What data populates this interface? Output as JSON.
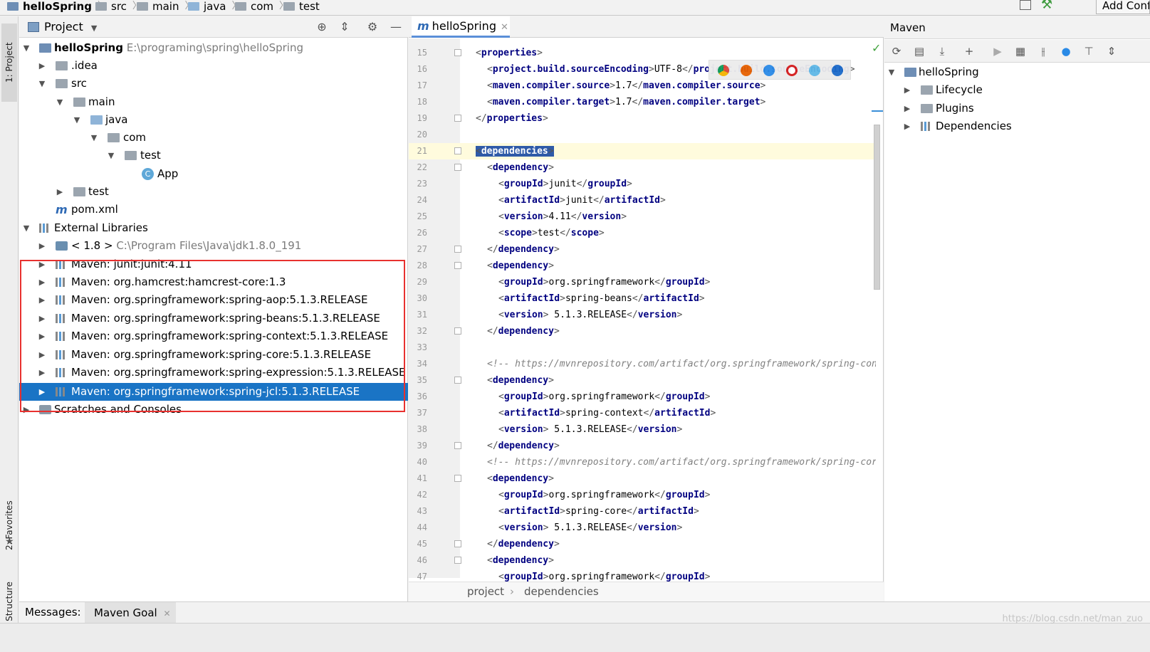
{
  "navbar": {
    "crumbs": [
      "helloSpring",
      "src",
      "main",
      "java",
      "com",
      "test"
    ],
    "add_config": "Add Conf"
  },
  "left_strip": {
    "project_tab": "1: Project",
    "favorites_tab": "2: Favorites",
    "structure_tab": "Z: Structure"
  },
  "project_panel": {
    "title": "Project",
    "tree": [
      {
        "label": "helloSpring",
        "path": "E:\\programing\\spring\\helloSpring"
      },
      {
        "label": ".idea"
      },
      {
        "label": "src"
      },
      {
        "label": "main"
      },
      {
        "label": "java"
      },
      {
        "label": "com"
      },
      {
        "label": "test"
      },
      {
        "label": "App"
      },
      {
        "label": "test"
      },
      {
        "label": "pom.xml"
      },
      {
        "label": "External Libraries"
      },
      {
        "label": "< 1.8 >",
        "path": "C:\\Program Files\\Java\\jdk1.8.0_191"
      },
      {
        "label": "Maven: junit:junit:4.11"
      },
      {
        "label": "Maven: org.hamcrest:hamcrest-core:1.3"
      },
      {
        "label": "Maven: org.springframework:spring-aop:5.1.3.RELEASE"
      },
      {
        "label": "Maven: org.springframework:spring-beans:5.1.3.RELEASE"
      },
      {
        "label": "Maven: org.springframework:spring-context:5.1.3.RELEASE"
      },
      {
        "label": "Maven: org.springframework:spring-core:5.1.3.RELEASE"
      },
      {
        "label": "Maven: org.springframework:spring-expression:5.1.3.RELEASE"
      },
      {
        "label": "Maven: org.springframework:spring-jcl:5.1.3.RELEASE"
      },
      {
        "label": "Scratches and Consoles"
      }
    ]
  },
  "editor": {
    "tab_icon": "m",
    "tab_label": "helloSpring",
    "lines": [
      {
        "n": "15",
        "open": "properties"
      },
      {
        "n": "16",
        "tag": "project.build.sourceEncoding",
        "text": "UTF-8"
      },
      {
        "n": "17",
        "tag": "maven.compiler.source",
        "text": "1.7"
      },
      {
        "n": "18",
        "tag": "maven.compiler.target",
        "text": "1.7"
      },
      {
        "n": "19",
        "close": "properties"
      },
      {
        "n": "20"
      },
      {
        "n": "21",
        "open": "dependencies"
      },
      {
        "n": "22",
        "open": "dependency"
      },
      {
        "n": "23",
        "tag": "groupId",
        "text": "junit"
      },
      {
        "n": "24",
        "tag": "artifactId",
        "text": "junit"
      },
      {
        "n": "25",
        "tag": "version",
        "text": "4.11"
      },
      {
        "n": "26",
        "tag": "scope",
        "text": "test"
      },
      {
        "n": "27",
        "close": "dependency"
      },
      {
        "n": "28",
        "open": "dependency"
      },
      {
        "n": "29",
        "tag": "groupId",
        "text": "org.springframework"
      },
      {
        "n": "30",
        "tag": "artifactId",
        "text": "spring-beans"
      },
      {
        "n": "31",
        "tag": "version",
        "text": " 5.1.3.RELEASE"
      },
      {
        "n": "32",
        "close": "dependency"
      },
      {
        "n": "33"
      },
      {
        "n": "34",
        "comment": "<!-- https://mvnrepository.com/artifact/org.springframework/spring-conte"
      },
      {
        "n": "35",
        "open": "dependency"
      },
      {
        "n": "36",
        "tag": "groupId",
        "text": "org.springframework"
      },
      {
        "n": "37",
        "tag": "artifactId",
        "text": "spring-context"
      },
      {
        "n": "38",
        "tag": "version",
        "text": " 5.1.3.RELEASE"
      },
      {
        "n": "39",
        "close": "dependency"
      },
      {
        "n": "40",
        "comment": "<!-- https://mvnrepository.com/artifact/org.springframework/spring-core"
      },
      {
        "n": "41",
        "open": "dependency"
      },
      {
        "n": "42",
        "tag": "groupId",
        "text": "org.springframework"
      },
      {
        "n": "43",
        "tag": "artifactId",
        "text": "spring-core"
      },
      {
        "n": "44",
        "tag": "version",
        "text": " 5.1.3.RELEASE"
      },
      {
        "n": "45",
        "close": "dependency"
      },
      {
        "n": "46",
        "open": "dependency"
      },
      {
        "n": "47",
        "tag": "groupId",
        "text": "org.springframework"
      }
    ],
    "breadcrumb": [
      "project",
      "dependencies"
    ]
  },
  "maven": {
    "title": "Maven",
    "tree": [
      {
        "label": "helloSpring"
      },
      {
        "label": "Lifecycle"
      },
      {
        "label": "Plugins"
      },
      {
        "label": "Dependencies"
      }
    ]
  },
  "bottom": {
    "messages_label": "Messages:",
    "tab_label": "Maven Goal"
  },
  "watermark": "https://blog.csdn.net/man_zuo",
  "colors": {
    "selection": "#1a74c5",
    "highlight_box": "#e8312f",
    "xml_tag": "#000080",
    "comment": "#808080"
  }
}
